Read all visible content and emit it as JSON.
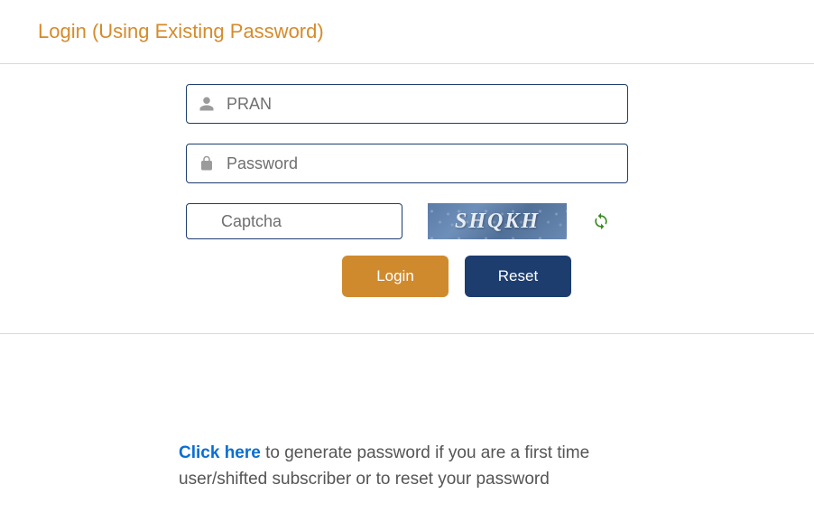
{
  "header": {
    "title": "Login  (Using Existing Password)"
  },
  "form": {
    "pran": {
      "placeholder": "PRAN",
      "value": ""
    },
    "password": {
      "placeholder": "Password",
      "value": ""
    },
    "captcha": {
      "placeholder": "Captcha",
      "value": "",
      "image_text": "SHQKH"
    },
    "buttons": {
      "login": "Login",
      "reset": "Reset"
    }
  },
  "help": {
    "link_text": "Click here",
    "rest_text": " to generate password if you are a first time user/shifted subscriber or to reset your password"
  }
}
